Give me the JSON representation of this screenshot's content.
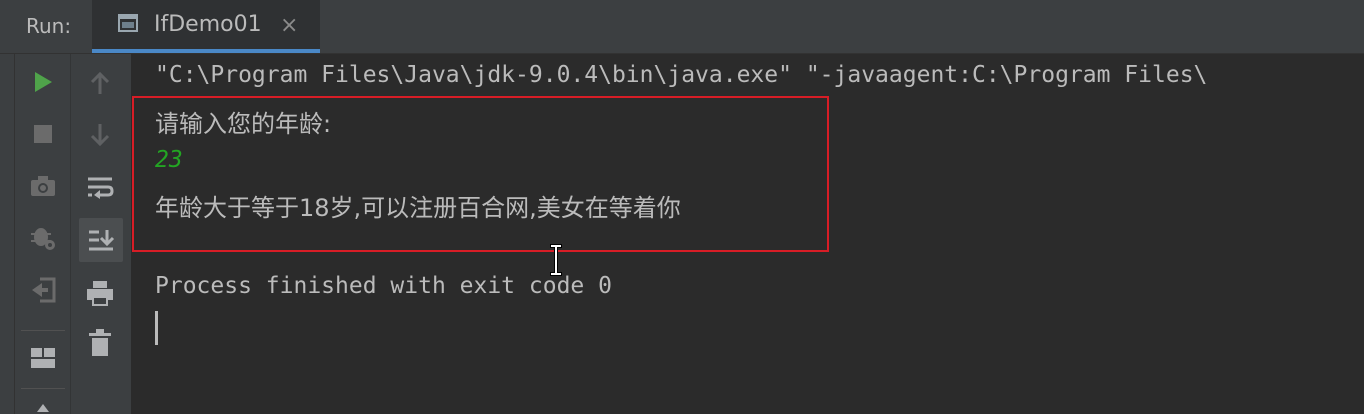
{
  "panel": {
    "run_label": "Run:",
    "tab": {
      "title": "IfDemo01",
      "close_glyph": "×",
      "icon": "console-window-icon"
    }
  },
  "toolbar_primary": [
    {
      "name": "rerun-icon",
      "color": "#4fa34a"
    },
    {
      "name": "stop-icon",
      "color": "#6b6b6b"
    },
    {
      "name": "dump-threads-icon",
      "color": "#6b6b6b"
    },
    {
      "name": "debug-settings-icon",
      "color": "#6b6b6b"
    },
    {
      "name": "exit-icon",
      "color": "#6b6b6b"
    },
    {
      "name": "layout-icon",
      "color": "#afb1b3"
    }
  ],
  "toolbar_secondary": [
    {
      "name": "up-arrow-icon"
    },
    {
      "name": "down-arrow-icon"
    },
    {
      "name": "soft-wrap-icon"
    },
    {
      "name": "scroll-to-end-icon",
      "selected": true
    },
    {
      "name": "print-icon"
    },
    {
      "name": "trash-icon"
    }
  ],
  "console": {
    "command_line": "\"C:\\Program Files\\Java\\jdk-9.0.4\\bin\\java.exe\" \"-javaagent:C:\\Program Files\\",
    "prompt": "请输入您的年龄:",
    "user_input": "23",
    "result": "年龄大于等于18岁,可以注册百合网,美女在等着你",
    "exit_message": "Process finished with exit code 0"
  },
  "colors": {
    "background": "#2b2b2b",
    "toolbar": "#3c3f41",
    "text": "#bbbbbb",
    "input_green": "#23a523",
    "tab_accent": "#4a88c7",
    "highlight_red": "#d71d26"
  }
}
